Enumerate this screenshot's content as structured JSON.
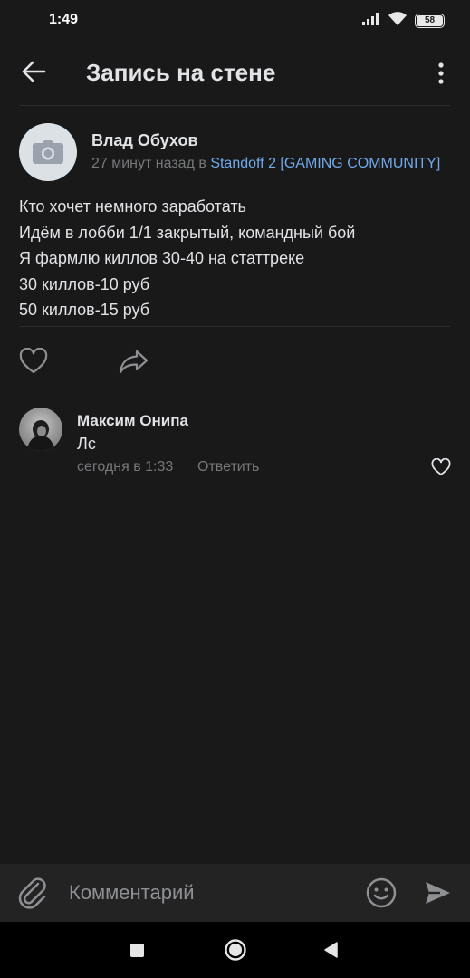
{
  "status_bar": {
    "time": "1:49",
    "battery": "58"
  },
  "header": {
    "title": "Запись на стене"
  },
  "post": {
    "author": "Влад Обухов",
    "time_prefix": "27 минут назад в ",
    "source": "Standoff 2 [GAMING COMMUNITY]",
    "lines": [
      "Кто хочет немного заработать",
      "Идём в лобби 1/1 закрытый, командный бой",
      "Я фармлю киллов 30-40 на статтреке",
      "30 киллов-10 руб",
      "50 киллов-15 руб"
    ]
  },
  "comment": {
    "author": "Максим Онипа",
    "text": "Лс",
    "time": "сегодня в 1:33",
    "reply_label": "Ответить"
  },
  "composer": {
    "placeholder": "Комментарий"
  },
  "colors": {
    "background": "#19191a",
    "accent_link": "#71aaeb",
    "secondary_text": "#76787a",
    "primary_text": "#e1e3e6"
  }
}
